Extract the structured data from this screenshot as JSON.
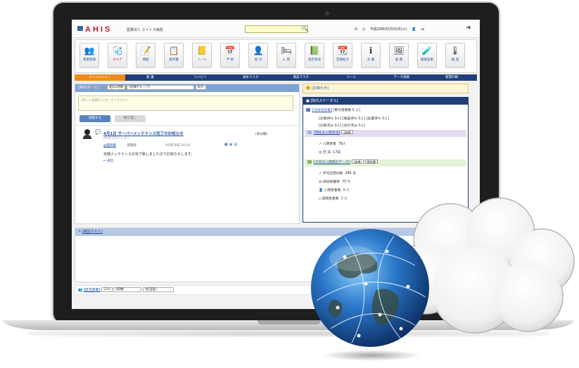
{
  "app": {
    "logo": "AHIS",
    "org": "医療法人 エイトス病院"
  },
  "header": {
    "search": {
      "value": ""
    },
    "date": "平成28年05月02日(火)",
    "user": "ss"
  },
  "iconbar": {
    "items": [
      {
        "label": "患者情報",
        "icon": "patients-icon",
        "glyph": "👥"
      },
      {
        "label": "カルテ",
        "icon": "chart-icon",
        "glyph": "🩺"
      },
      {
        "label": "病歴",
        "icon": "history-icon",
        "glyph": "📝"
      },
      {
        "label": "指示箋",
        "icon": "instruction-icon",
        "glyph": "📋"
      },
      {
        "label": "ノート",
        "icon": "note-icon",
        "glyph": "📒"
      },
      {
        "label": "予 約",
        "icon": "calendar-icon",
        "glyph": "📅"
      },
      {
        "label": "受 付",
        "icon": "reception-icon",
        "glyph": "👤"
      },
      {
        "label": "入 院",
        "icon": "admission-icon",
        "glyph": "🛏"
      },
      {
        "label": "指示状況",
        "icon": "status-icon",
        "glyph": "📗"
      },
      {
        "label": "定期処方",
        "icon": "prescription-icon",
        "glyph": "📆"
      },
      {
        "label": "文 書",
        "icon": "document-icon",
        "glyph": "ℹ"
      },
      {
        "label": "画 像",
        "icon": "image-icon",
        "glyph": "🖼"
      },
      {
        "label": "検査結果",
        "icon": "lab-result-icon",
        "glyph": "🧪"
      },
      {
        "label": "検 温",
        "icon": "thermometer-icon",
        "glyph": "🌡"
      }
    ]
  },
  "menu": {
    "items": [
      "メインメニュー",
      "看 護",
      "リハビリ",
      "基本マスタ",
      "施設マスタ",
      "ツール",
      "データ連携",
      "帳票印刷"
    ],
    "active_index": 0
  },
  "board": {
    "title": "[院内ボード]",
    "filter1": "過去2週間",
    "filter2": "(役職グループ)",
    "display_btn": "表示",
    "compose_placeholder": "(新しい投稿を入力してください)",
    "post_button": "投稿する",
    "cancel_button": "取り消し",
    "post": {
      "title": "4月1日 サーバーメンテナンス完了のお知らせ",
      "author": "AHISプロジェクト",
      "unread": "(未分類)",
      "tag": "@医師業",
      "role": "管理者",
      "datetime": "01月29日 16:16",
      "body": "定期メンテナンスが完了致しましたのでお知らせします。",
      "reply": "返信"
    }
  },
  "notice": {
    "title": "[お知らせ]"
  },
  "status": {
    "title": "[院内ステータス]",
    "outpatient_link": "[今日の外来]",
    "outpatient_count": "[受付患者数 0 人]",
    "line1": "[診察待ち 0人] [検査待ち 0人] [処置待ち 0人]",
    "line2": "[診察済み 0人] [会計済み 0人]",
    "inpatient_link": "[現在の入院状況]",
    "inpatient_select": "(病棟)",
    "admitted_label": "入院患者",
    "admitted_value": "78人",
    "vacant_label": "空 床",
    "vacant_value": "17床",
    "stats_link": "[今月の入院統計データ]",
    "stats_select": "(病棟)",
    "stats_btn": "再計算",
    "avg_stay_label": "平均在院日数",
    "avg_stay_value": "286 日",
    "occupancy_label": "病床稼働率",
    "occupancy_value": "75 %",
    "new_admit_label": "入院患者数",
    "new_admit_value": "0 人",
    "discharge_label": "退院患者数",
    "discharge_value": "1 人"
  },
  "karte": {
    "title": "[確認カルテ]"
  },
  "patients": {
    "title": "[担当患者]",
    "select1": "(22)",
    "select2": "(病棟)",
    "select3": "(担当医)"
  },
  "colors": {
    "brand": "#c0182a",
    "navy": "#1f3f7a",
    "accent": "#f08a1c"
  }
}
